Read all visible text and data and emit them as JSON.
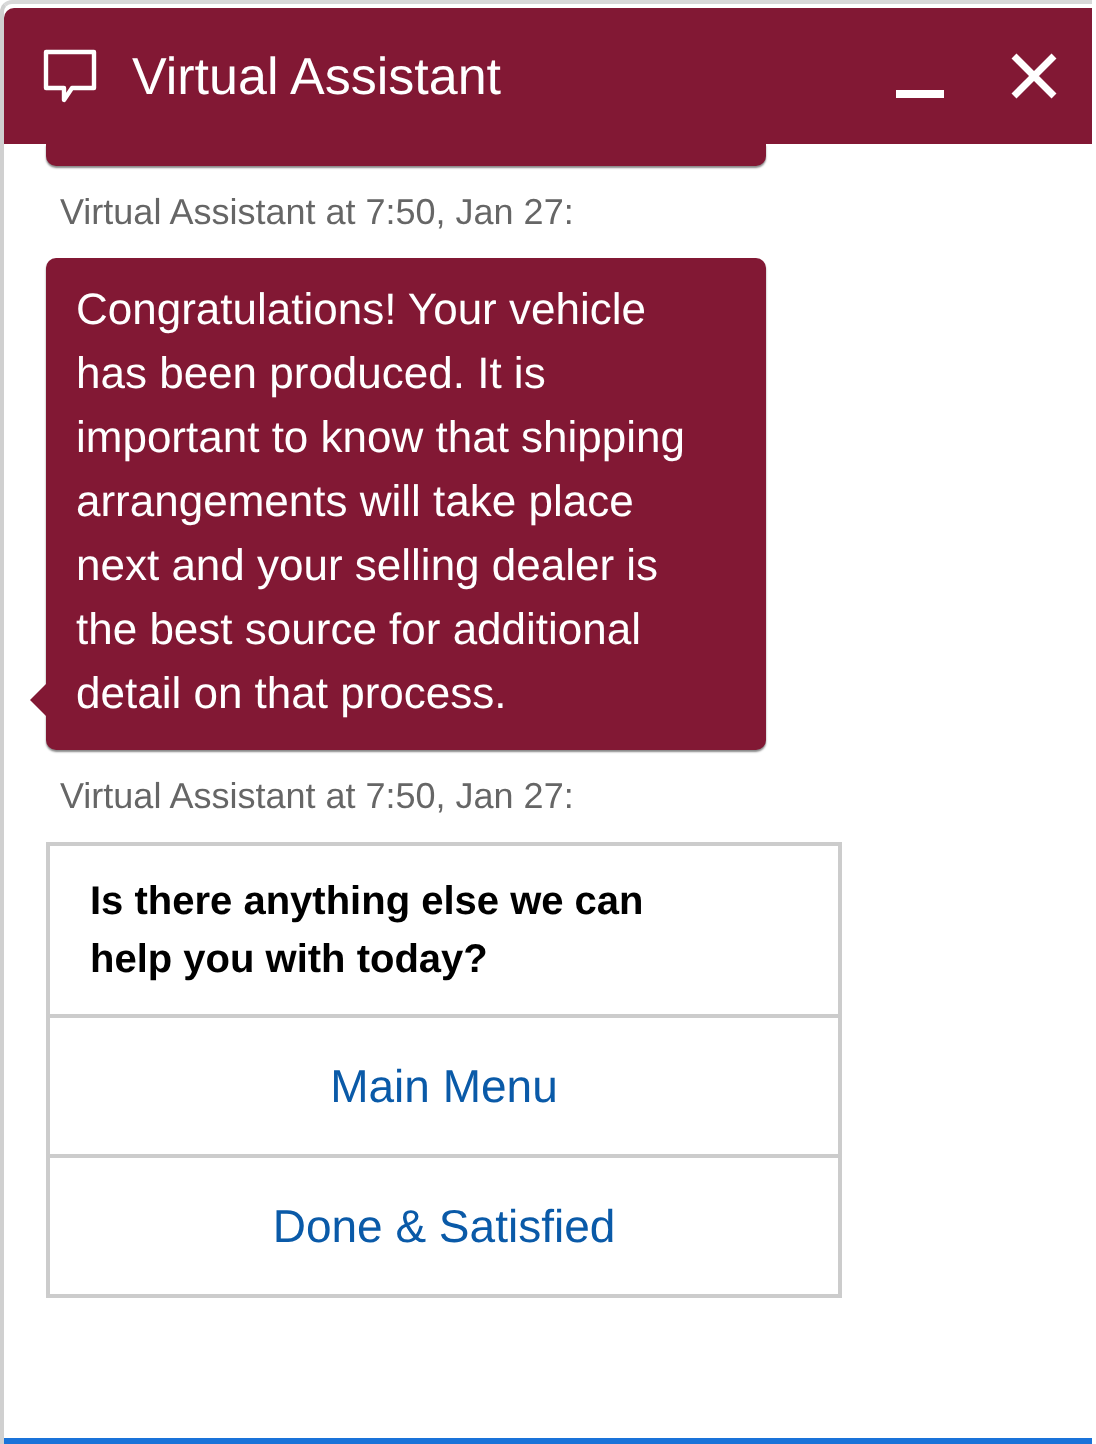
{
  "window": {
    "title": "Virtual Assistant"
  },
  "messages": [
    {
      "kind": "text",
      "meta": "Virtual Assistant at 7:50, Jan 27:",
      "text": "Congratulations! Your vehicle has been produced. It is important to know that shipping arrangements will take place next and your selling dealer is the best source for additional detail on that process."
    },
    {
      "kind": "options",
      "meta": "Virtual Assistant at 7:50, Jan 27:",
      "question": "Is there anything else we can help you with today?",
      "options": [
        "Main Menu",
        "Done & Satisfied"
      ]
    }
  ]
}
